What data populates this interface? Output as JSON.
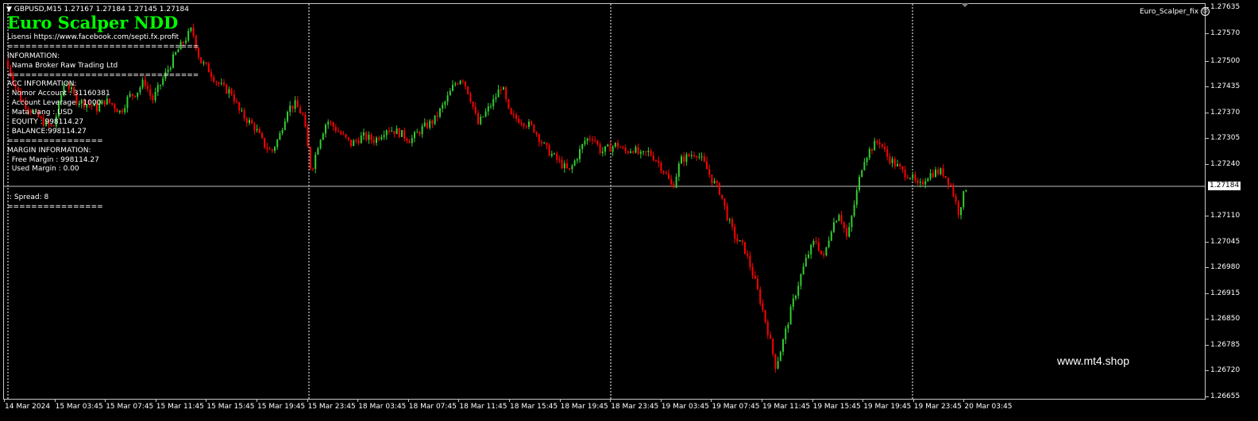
{
  "header": {
    "symbol_line": "GBPUSD,M15  1.27167 1.27184 1.27145 1.27184",
    "ea_name": "Euro_Scalper_fix",
    "ea_icon": "smiley-icon"
  },
  "panel": {
    "title": "Euro Scalper NDD",
    "lines": [
      "Lisensi https://www.facebook.com/septi.fx.profit",
      "================================",
      "INFORMATION:",
      "  Nama Broker Raw Trading Ltd",
      "================================",
      "ACC INFORMATION:",
      "  Nomor Account : 31160381",
      "  Account Leverage : 1000",
      "  Mata Uang : USD",
      "  EQUITY : 998114.27",
      "  BALANCE:998114.27",
      "================",
      "MARGIN INFORMATION:",
      "  Free Margin : 998114.27",
      "  Used Margin : 0.00",
      "",
      "",
      ":: Spread: 8",
      "================"
    ]
  },
  "watermark": "www.mt4.shop",
  "price_axis": {
    "labels": [
      "1.27635",
      "1.27570",
      "1.27500",
      "1.27435",
      "1.27370",
      "1.27305",
      "1.27240",
      "1.27110",
      "1.27045",
      "1.26980",
      "1.26915",
      "1.26850",
      "1.26785",
      "1.26720",
      "1.26655"
    ],
    "current": "1.27184"
  },
  "time_axis": {
    "labels": [
      "14 Mar 2024",
      "15 Mar 03:45",
      "15 Mar 07:45",
      "15 Mar 11:45",
      "15 Mar 15:45",
      "15 Mar 19:45",
      "15 Mar 23:45",
      "18 Mar 03:45",
      "18 Mar 07:45",
      "18 Mar 11:45",
      "18 Mar 15:45",
      "18 Mar 19:45",
      "18 Mar 23:45",
      "19 Mar 03:45",
      "19 Mar 07:45",
      "19 Mar 11:45",
      "19 Mar 15:45",
      "19 Mar 19:45",
      "19 Mar 23:45",
      "20 Mar 03:45"
    ]
  },
  "colors": {
    "bull": "#32cd32",
    "bear": "#ff0000",
    "title": "#00ff00",
    "background": "#000000",
    "grid": "#c8c8c8"
  },
  "chart_data": {
    "type": "candlestick",
    "symbol": "GBPUSD",
    "timeframe": "M15",
    "ylim": [
      1.26655,
      1.27635
    ],
    "current_price": 1.27184,
    "close_path": [
      [
        0,
        1.275
      ],
      [
        20,
        1.274
      ],
      [
        30,
        1.2738
      ],
      [
        45,
        1.2735
      ],
      [
        60,
        1.2733
      ],
      [
        75,
        1.2745
      ],
      [
        90,
        1.274
      ],
      [
        105,
        1.2739
      ],
      [
        115,
        1.2738
      ],
      [
        125,
        1.274
      ],
      [
        135,
        1.2739
      ],
      [
        145,
        1.2737
      ],
      [
        155,
        1.2741
      ],
      [
        165,
        1.2742
      ],
      [
        175,
        1.2745
      ],
      [
        185,
        1.274
      ],
      [
        195,
        1.2744
      ],
      [
        205,
        1.2748
      ],
      [
        215,
        1.2752
      ],
      [
        225,
        1.2755
      ],
      [
        235,
        1.2758
      ],
      [
        245,
        1.275
      ],
      [
        255,
        1.2748
      ],
      [
        265,
        1.2745
      ],
      [
        275,
        1.2743
      ],
      [
        285,
        1.2742
      ],
      [
        295,
        1.2737
      ],
      [
        305,
        1.2735
      ],
      [
        315,
        1.2733
      ],
      [
        325,
        1.2729
      ],
      [
        335,
        1.2727
      ],
      [
        345,
        1.2731
      ],
      [
        355,
        1.2738
      ],
      [
        365,
        1.2739
      ],
      [
        375,
        1.2736
      ],
      [
        385,
        1.2722
      ],
      [
        395,
        1.273
      ],
      [
        405,
        1.2735
      ],
      [
        420,
        1.2732
      ],
      [
        435,
        1.2729
      ],
      [
        450,
        1.2731
      ],
      [
        465,
        1.273
      ],
      [
        480,
        1.2733
      ],
      [
        495,
        1.2732
      ],
      [
        510,
        1.273
      ],
      [
        525,
        1.2733
      ],
      [
        540,
        1.2735
      ],
      [
        555,
        1.274
      ],
      [
        565,
        1.2744
      ],
      [
        575,
        1.2746
      ],
      [
        585,
        1.2741
      ],
      [
        595,
        1.2734
      ],
      [
        605,
        1.2737
      ],
      [
        615,
        1.274
      ],
      [
        625,
        1.2744
      ],
      [
        635,
        1.2736
      ],
      [
        650,
        1.2735
      ],
      [
        665,
        1.2733
      ],
      [
        680,
        1.2728
      ],
      [
        695,
        1.2725
      ],
      [
        710,
        1.2722
      ],
      [
        720,
        1.2726
      ],
      [
        730,
        1.273
      ],
      [
        740,
        1.2731
      ],
      [
        750,
        1.2727
      ],
      [
        760,
        1.2728
      ],
      [
        770,
        1.2729
      ],
      [
        780,
        1.2727
      ],
      [
        790,
        1.2728
      ],
      [
        800,
        1.2726
      ],
      [
        810,
        1.2727
      ],
      [
        820,
        1.2725
      ],
      [
        830,
        1.2722
      ],
      [
        840,
        1.2718
      ],
      [
        850,
        1.2725
      ],
      [
        860,
        1.2726
      ],
      [
        870,
        1.2727
      ],
      [
        880,
        1.2724
      ],
      [
        890,
        1.272
      ],
      [
        900,
        1.2717
      ],
      [
        910,
        1.271
      ],
      [
        920,
        1.2705
      ],
      [
        930,
        1.2703
      ],
      [
        940,
        1.2697
      ],
      [
        950,
        1.269
      ],
      [
        960,
        1.2682
      ],
      [
        970,
        1.2673
      ],
      [
        980,
        1.268
      ],
      [
        990,
        1.2688
      ],
      [
        1000,
        1.2695
      ],
      [
        1010,
        1.2701
      ],
      [
        1020,
        1.2705
      ],
      [
        1030,
        1.27
      ],
      [
        1040,
        1.2708
      ],
      [
        1050,
        1.2712
      ],
      [
        1060,
        1.2705
      ],
      [
        1070,
        1.2715
      ],
      [
        1080,
        1.2725
      ],
      [
        1090,
        1.2728
      ],
      [
        1100,
        1.273
      ],
      [
        1110,
        1.2726
      ],
      [
        1120,
        1.2724
      ],
      [
        1130,
        1.2722
      ],
      [
        1140,
        1.2721
      ],
      [
        1150,
        1.2718
      ],
      [
        1160,
        1.2721
      ],
      [
        1170,
        1.2722
      ],
      [
        1180,
        1.2722
      ],
      [
        1190,
        1.2719
      ],
      [
        1200,
        1.2712
      ],
      [
        1210,
        1.27184
      ]
    ]
  }
}
